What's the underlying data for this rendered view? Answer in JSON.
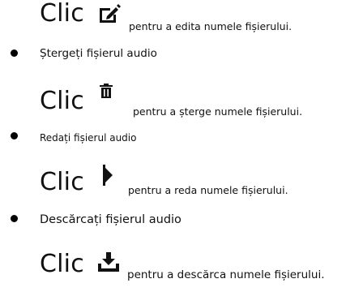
{
  "steps": [
    {
      "clic": "Clic",
      "icon": "edit-icon",
      "text": "pentru a edita numele fișierului."
    },
    {
      "bullet": "Ștergeți fișierul audio",
      "clic": "Clic",
      "icon": "trash-icon",
      "text": "pentru a șterge numele fișierului."
    },
    {
      "bullet": "Redați fișierul audio",
      "clic": "Clic",
      "icon": "play-icon",
      "text": "pentru a reda numele fișierului."
    },
    {
      "bullet": "Descărcați fișierul audio",
      "clic": "Clic",
      "icon": "download-icon",
      "text": "pentru a descărca numele fișierului."
    }
  ]
}
